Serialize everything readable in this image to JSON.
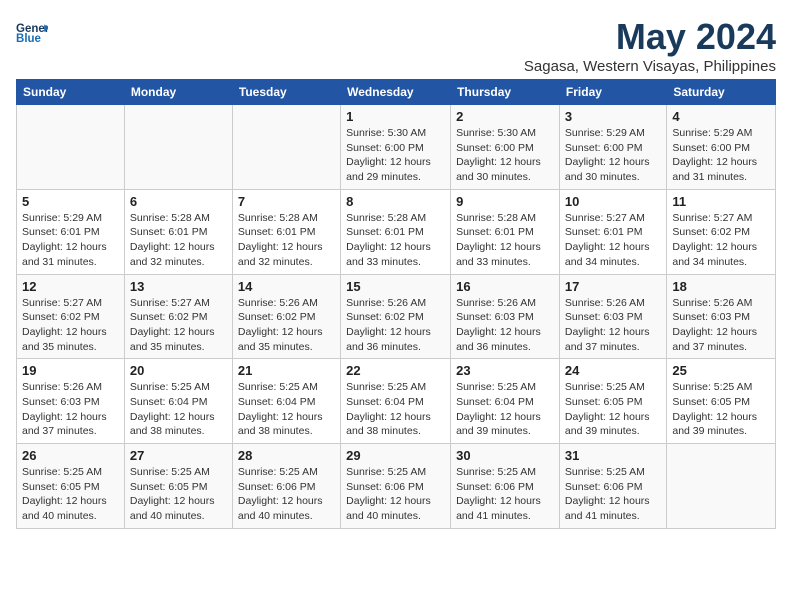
{
  "header": {
    "logo_line1": "General",
    "logo_line2": "Blue",
    "month": "May 2024",
    "location": "Sagasa, Western Visayas, Philippines"
  },
  "days_of_week": [
    "Sunday",
    "Monday",
    "Tuesday",
    "Wednesday",
    "Thursday",
    "Friday",
    "Saturday"
  ],
  "weeks": [
    [
      {
        "day": "",
        "info": ""
      },
      {
        "day": "",
        "info": ""
      },
      {
        "day": "",
        "info": ""
      },
      {
        "day": "1",
        "info": "Sunrise: 5:30 AM\nSunset: 6:00 PM\nDaylight: 12 hours\nand 29 minutes."
      },
      {
        "day": "2",
        "info": "Sunrise: 5:30 AM\nSunset: 6:00 PM\nDaylight: 12 hours\nand 30 minutes."
      },
      {
        "day": "3",
        "info": "Sunrise: 5:29 AM\nSunset: 6:00 PM\nDaylight: 12 hours\nand 30 minutes."
      },
      {
        "day": "4",
        "info": "Sunrise: 5:29 AM\nSunset: 6:00 PM\nDaylight: 12 hours\nand 31 minutes."
      }
    ],
    [
      {
        "day": "5",
        "info": "Sunrise: 5:29 AM\nSunset: 6:01 PM\nDaylight: 12 hours\nand 31 minutes."
      },
      {
        "day": "6",
        "info": "Sunrise: 5:28 AM\nSunset: 6:01 PM\nDaylight: 12 hours\nand 32 minutes."
      },
      {
        "day": "7",
        "info": "Sunrise: 5:28 AM\nSunset: 6:01 PM\nDaylight: 12 hours\nand 32 minutes."
      },
      {
        "day": "8",
        "info": "Sunrise: 5:28 AM\nSunset: 6:01 PM\nDaylight: 12 hours\nand 33 minutes."
      },
      {
        "day": "9",
        "info": "Sunrise: 5:28 AM\nSunset: 6:01 PM\nDaylight: 12 hours\nand 33 minutes."
      },
      {
        "day": "10",
        "info": "Sunrise: 5:27 AM\nSunset: 6:01 PM\nDaylight: 12 hours\nand 34 minutes."
      },
      {
        "day": "11",
        "info": "Sunrise: 5:27 AM\nSunset: 6:02 PM\nDaylight: 12 hours\nand 34 minutes."
      }
    ],
    [
      {
        "day": "12",
        "info": "Sunrise: 5:27 AM\nSunset: 6:02 PM\nDaylight: 12 hours\nand 35 minutes."
      },
      {
        "day": "13",
        "info": "Sunrise: 5:27 AM\nSunset: 6:02 PM\nDaylight: 12 hours\nand 35 minutes."
      },
      {
        "day": "14",
        "info": "Sunrise: 5:26 AM\nSunset: 6:02 PM\nDaylight: 12 hours\nand 35 minutes."
      },
      {
        "day": "15",
        "info": "Sunrise: 5:26 AM\nSunset: 6:02 PM\nDaylight: 12 hours\nand 36 minutes."
      },
      {
        "day": "16",
        "info": "Sunrise: 5:26 AM\nSunset: 6:03 PM\nDaylight: 12 hours\nand 36 minutes."
      },
      {
        "day": "17",
        "info": "Sunrise: 5:26 AM\nSunset: 6:03 PM\nDaylight: 12 hours\nand 37 minutes."
      },
      {
        "day": "18",
        "info": "Sunrise: 5:26 AM\nSunset: 6:03 PM\nDaylight: 12 hours\nand 37 minutes."
      }
    ],
    [
      {
        "day": "19",
        "info": "Sunrise: 5:26 AM\nSunset: 6:03 PM\nDaylight: 12 hours\nand 37 minutes."
      },
      {
        "day": "20",
        "info": "Sunrise: 5:25 AM\nSunset: 6:04 PM\nDaylight: 12 hours\nand 38 minutes."
      },
      {
        "day": "21",
        "info": "Sunrise: 5:25 AM\nSunset: 6:04 PM\nDaylight: 12 hours\nand 38 minutes."
      },
      {
        "day": "22",
        "info": "Sunrise: 5:25 AM\nSunset: 6:04 PM\nDaylight: 12 hours\nand 38 minutes."
      },
      {
        "day": "23",
        "info": "Sunrise: 5:25 AM\nSunset: 6:04 PM\nDaylight: 12 hours\nand 39 minutes."
      },
      {
        "day": "24",
        "info": "Sunrise: 5:25 AM\nSunset: 6:05 PM\nDaylight: 12 hours\nand 39 minutes."
      },
      {
        "day": "25",
        "info": "Sunrise: 5:25 AM\nSunset: 6:05 PM\nDaylight: 12 hours\nand 39 minutes."
      }
    ],
    [
      {
        "day": "26",
        "info": "Sunrise: 5:25 AM\nSunset: 6:05 PM\nDaylight: 12 hours\nand 40 minutes."
      },
      {
        "day": "27",
        "info": "Sunrise: 5:25 AM\nSunset: 6:05 PM\nDaylight: 12 hours\nand 40 minutes."
      },
      {
        "day": "28",
        "info": "Sunrise: 5:25 AM\nSunset: 6:06 PM\nDaylight: 12 hours\nand 40 minutes."
      },
      {
        "day": "29",
        "info": "Sunrise: 5:25 AM\nSunset: 6:06 PM\nDaylight: 12 hours\nand 40 minutes."
      },
      {
        "day": "30",
        "info": "Sunrise: 5:25 AM\nSunset: 6:06 PM\nDaylight: 12 hours\nand 41 minutes."
      },
      {
        "day": "31",
        "info": "Sunrise: 5:25 AM\nSunset: 6:06 PM\nDaylight: 12 hours\nand 41 minutes."
      },
      {
        "day": "",
        "info": ""
      }
    ]
  ]
}
